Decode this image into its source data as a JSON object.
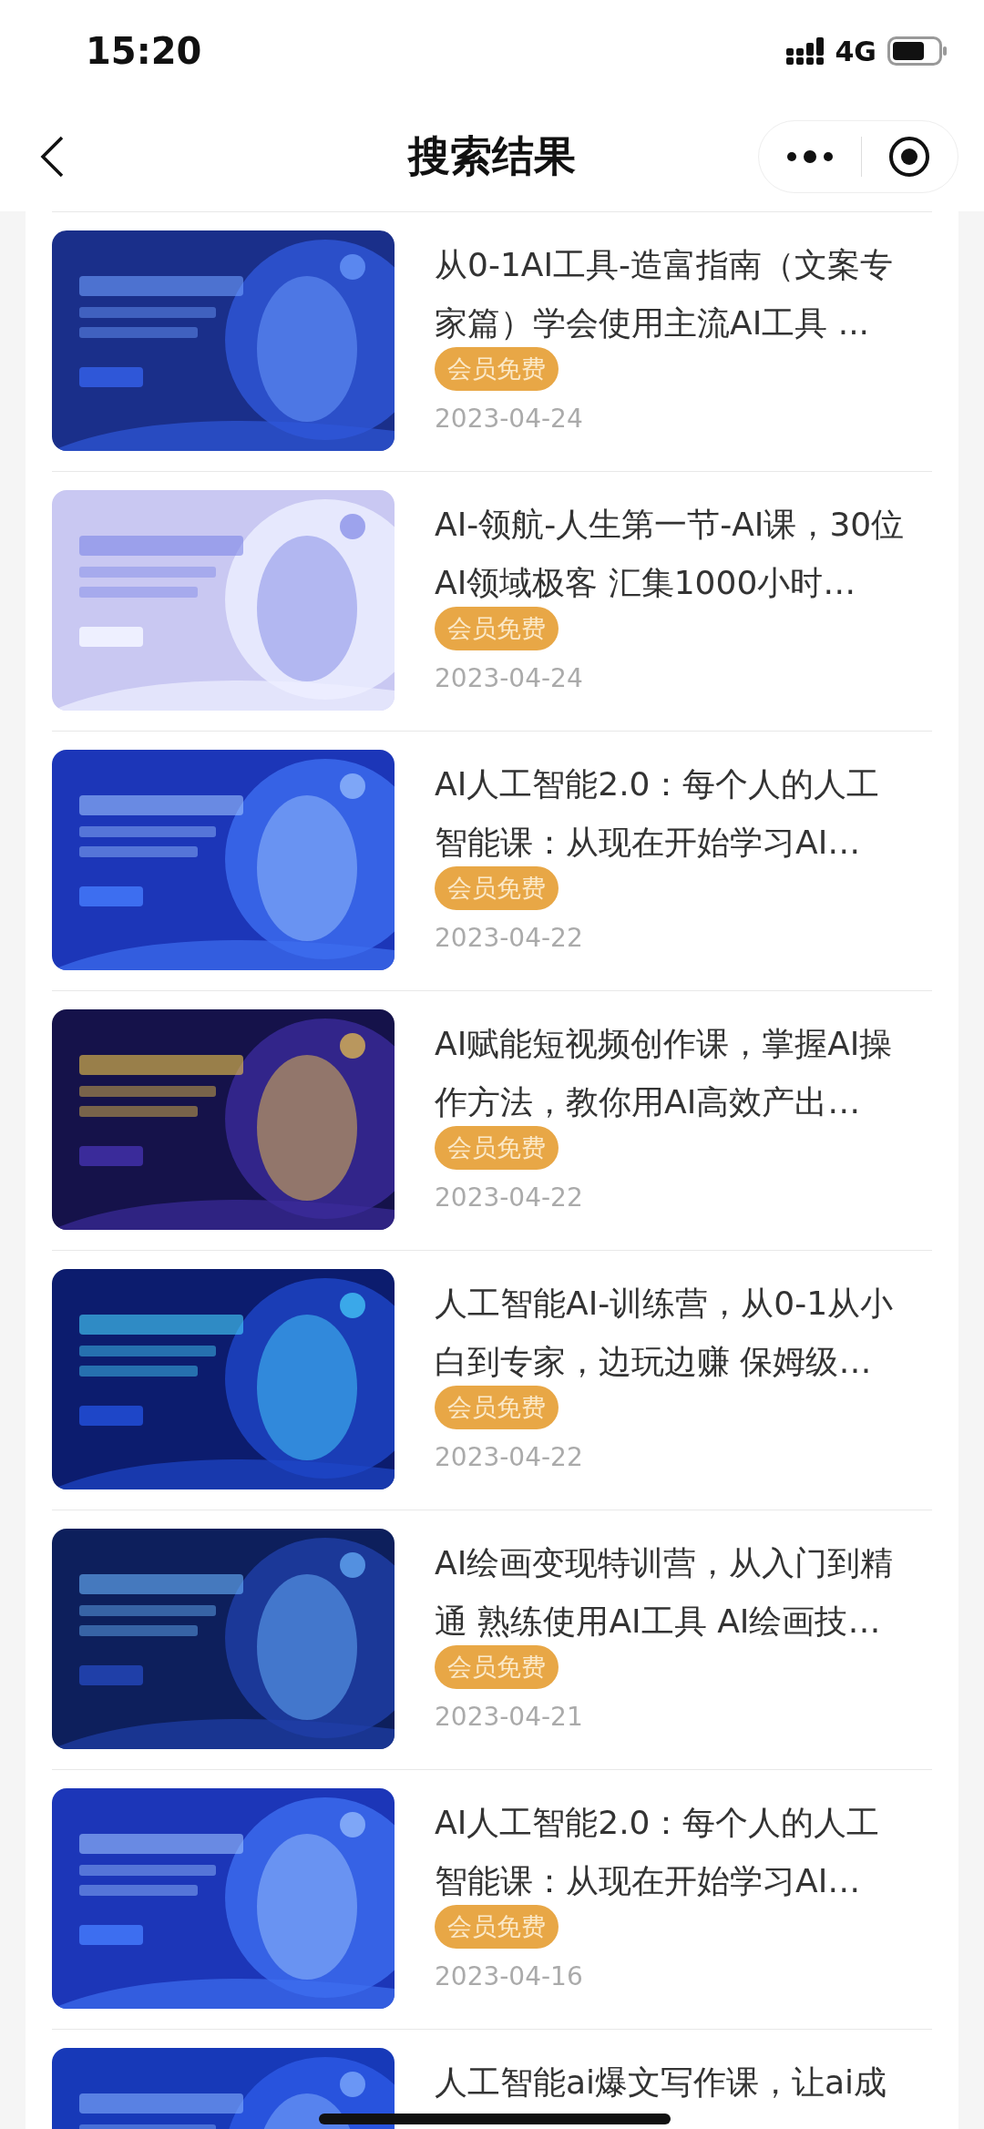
{
  "status_bar": {
    "time": "15:20",
    "network": "4G"
  },
  "header": {
    "title": "搜索结果"
  },
  "results": [
    {
      "title": "从0-1AI工具-造富指南（文案专家篇）学会使用主流AI工具 ...",
      "badge": "会员免费",
      "date": "2023-04-24"
    },
    {
      "title": "AI-领航-人生第一节-AI课，30位AI领域极客 汇集1000小时…",
      "badge": "会员免费",
      "date": "2023-04-24"
    },
    {
      "title": "AI人工智能2.0：每个人的人工智能课：从现在开始学习AI…",
      "badge": "会员免费",
      "date": "2023-04-22"
    },
    {
      "title": "AI赋能短视频创作课，掌握AI操作方法，教你用AI高效产出…",
      "badge": "会员免费",
      "date": "2023-04-22"
    },
    {
      "title": "人工智能AI-训练营，从0-1从小白到专家，边玩边赚 保姆级…",
      "badge": "会员免费",
      "date": "2023-04-22"
    },
    {
      "title": "AI绘画变现特训营，从入门到精通 熟练使用AI工具 AI绘画技…",
      "badge": "会员免费",
      "date": "2023-04-21"
    },
    {
      "title": "AI人工智能2.0：每个人的人工智能课：从现在开始学习AI…",
      "badge": "会员免费",
      "date": "2023-04-16"
    },
    {
      "title": "人工智能ai爆文写作课，让ai成"
    }
  ]
}
